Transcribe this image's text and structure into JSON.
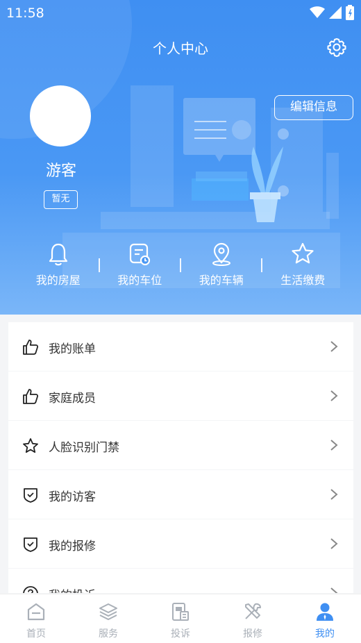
{
  "status_bar": {
    "time": "11:58"
  },
  "header": {
    "title": "个人中心",
    "edit_label": "编辑信息"
  },
  "profile": {
    "name": "游客",
    "badge": "暂无"
  },
  "quick_actions": [
    {
      "label": "我的房屋",
      "icon": "bell-icon"
    },
    {
      "label": "我的车位",
      "icon": "parking-clock-icon"
    },
    {
      "label": "我的车辆",
      "icon": "location-pin-icon"
    },
    {
      "label": "生活缴费",
      "icon": "star-icon"
    }
  ],
  "menu": [
    {
      "label": "我的账单",
      "icon": "thumbs-up-icon"
    },
    {
      "label": "家庭成员",
      "icon": "thumbs-up-icon"
    },
    {
      "label": "人脸识别门禁",
      "icon": "star-icon"
    },
    {
      "label": "我的访客",
      "icon": "shield-check-icon"
    },
    {
      "label": "我的报修",
      "icon": "shield-check-icon"
    },
    {
      "label": "我的投诉",
      "icon": "help-icon"
    }
  ],
  "tabs": [
    {
      "label": "首页",
      "icon": "home-icon",
      "active": false
    },
    {
      "label": "服务",
      "icon": "layers-icon",
      "active": false
    },
    {
      "label": "投诉",
      "icon": "document-icon",
      "active": false
    },
    {
      "label": "报修",
      "icon": "tools-icon",
      "active": false
    },
    {
      "label": "我的",
      "icon": "user-icon",
      "active": true
    }
  ],
  "colors": {
    "primary": "#3f8ff2",
    "tab_inactive": "#aab0b8",
    "text": "#333333"
  }
}
